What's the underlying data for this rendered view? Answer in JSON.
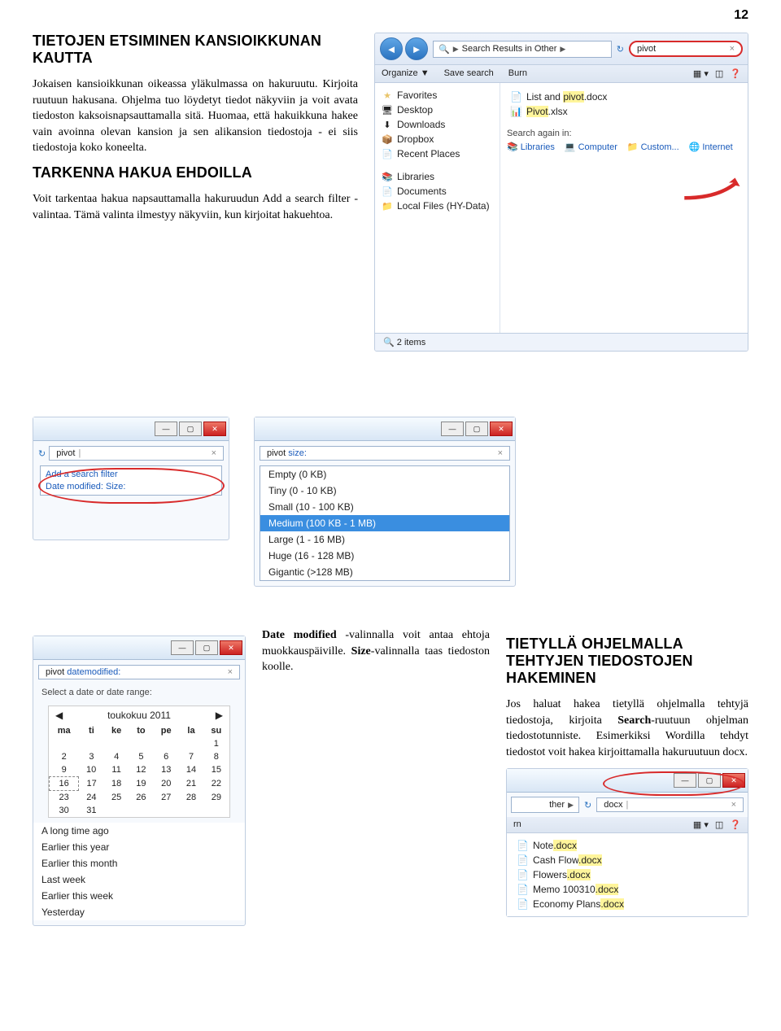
{
  "page_number": "12",
  "sec1": {
    "heading": "TIETOJEN ETSIMINEN KANSIOIKKUNAN KAUTTA",
    "p1": "Jokaisen kansioikkunan oikeassa ylä­kulmassa on hakuruutu. Kirjoita ruu­tuun hakusana. Ohjelma tuo löydetyt tiedot näkyviin ja voit avata tiedoston kaksoisnapsauttamalla sitä. Huomaa, että hakuikkuna hakee vain avoinna olevan kansion ja sen alikansion tiedos­toja - ei siis tiedostoja koko koneelta."
  },
  "sec2": {
    "heading": "TARKENNA HAKUA EHDOILLA",
    "p1": "Voit tarkentaa hakua napsauttamalla hakuruudun Add a search filter -va­lintaa. Tämä valinta ilmestyy näkyviin, kun kirjoitat hakuehtoa."
  },
  "explorer1": {
    "breadcrumb": "Search Results in Other",
    "search_value": "pivot",
    "toolbar": [
      "Organize ▼",
      "Save search",
      "Burn"
    ],
    "nav_fav": "Favorites",
    "nav_items": [
      "Desktop",
      "Downloads",
      "Dropbox",
      "Recent Places"
    ],
    "nav_lib": "Libraries",
    "nav_lib_items": [
      "Documents",
      "Local Files (HY-Data)"
    ],
    "file1_pre": "List and ",
    "file1_hl": "pivot",
    "file1_post": ".docx",
    "file2_pre": "",
    "file2_hl": "Pivot",
    "file2_post": ".xlsx",
    "search_again": "Search again in:",
    "links": [
      "Libraries",
      "Computer",
      "Custom...",
      "Internet"
    ],
    "status": "2 items"
  },
  "filter_shot": {
    "search_value": "pivot",
    "add_filter": "Add a search filter",
    "opts": "Date modified:   Size:"
  },
  "size_shot": {
    "search_value": "pivot size:",
    "items": [
      "Empty (0 KB)",
      "Tiny (0 - 10 KB)",
      "Small (10 - 100 KB)",
      "Medium (100 KB - 1 MB)",
      "Large (1 - 16 MB)",
      "Huge (16 - 128 MB)",
      "Gigantic (>128 MB)"
    ],
    "selected_idx": 3
  },
  "date_shot": {
    "search_value": "pivot datemodified:",
    "select_label": "Select a date or date range:",
    "month": "toukokuu 2011",
    "days": [
      "ma",
      "ti",
      "ke",
      "to",
      "pe",
      "la",
      "su"
    ],
    "ranges": [
      "A long time ago",
      "Earlier this year",
      "Earlier this month",
      "Last week",
      "Earlier this week",
      "Yesterday"
    ]
  },
  "sec3": {
    "p1": "Date modified -valinnalla voit antaa ehtoja muokkauspäiville. Size-valinnalla taas tiedoston koolle."
  },
  "sec4": {
    "heading": "TIETYLLÄ OHJELMALLA TEHTYJEN TIEDOSTOJEN HAKEMINEN",
    "p1": "Jos haluat hakea tietyllä ohjelmalla tehtyjä tiedostoja, kirjoita Search-ruutuun ohjelman tiedostotunniste. Esimerkiksi Wordilla tehdyt tiedostot voit hakea kirjoittamalla hakuruutuun docx."
  },
  "explorer2": {
    "breadcrumb_suffix": "ther",
    "search_value": "docx",
    "toolbar_frag": "rn",
    "files": [
      "Note.docx",
      "Cash Flow.docx",
      "Flowers.docx",
      "Memo 100310.docx",
      "Economy Plans.docx"
    ]
  }
}
